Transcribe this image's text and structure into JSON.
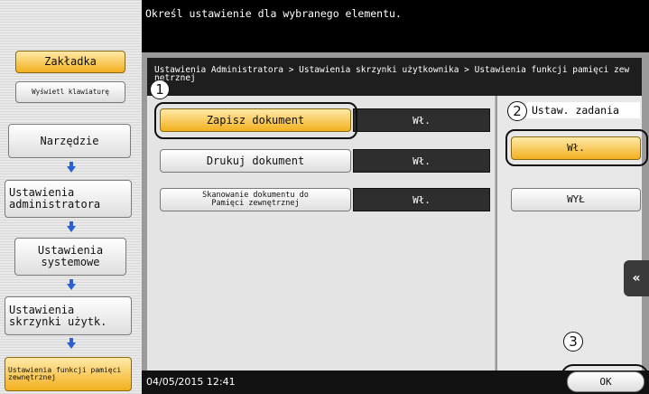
{
  "header": {
    "instruction": "Określ ustawienie dla wybranego elementu."
  },
  "sidebar": {
    "bookmark": "Zakładka",
    "show_keyboard": "Wyświetl klawiaturę",
    "tools": "Narzędzie",
    "admin_settings": "Ustawienia administratora",
    "system_settings": "Ustawienia systemowe",
    "box_settings": "Ustawienia skrzynki użytk.",
    "ext_memory_functions": "Ustawienia funkcji pamięci zewnętrznej"
  },
  "breadcrumb": "Ustawienia Administratora > Ustawienia skrzynki użytkownika > Ustawienia funkcji pamięci zewnętrznej",
  "list": [
    {
      "label": "Zapisz dokument",
      "value": "Wł."
    },
    {
      "label": "Drukuj dokument",
      "value": "Wł."
    },
    {
      "label": "Skanowanie dokumentu do Pamięci zewnętrznej",
      "value": "Wł."
    }
  ],
  "right": {
    "title": "Ustaw. zadania",
    "on_label": "Wł.",
    "off_label": "WYŁ"
  },
  "footer": {
    "datetime": "04/05/2015  12:41",
    "ok_label": "OK"
  },
  "callouts": [
    "1",
    "2",
    "3"
  ],
  "colors": {
    "accent_yellow": "#f2b01e",
    "arrow_blue": "#2a5fd6",
    "header_black": "#000000"
  }
}
